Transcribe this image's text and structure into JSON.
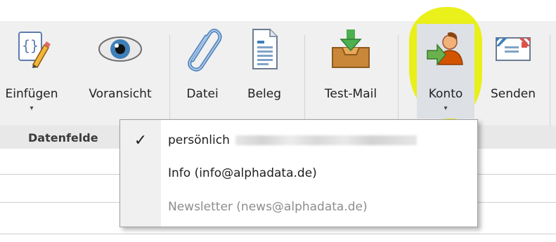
{
  "ribbon": {
    "buttons": [
      {
        "label": "Einfügen",
        "icon": "insert-field-icon",
        "has_dropdown": true
      },
      {
        "label": "Voransicht",
        "icon": "eye-icon",
        "has_dropdown": false
      },
      {
        "label": "Datei",
        "icon": "paperclip-icon",
        "has_dropdown": false
      },
      {
        "label": "Beleg",
        "icon": "document-icon",
        "has_dropdown": false
      },
      {
        "label": "Test-Mail",
        "icon": "inbox-download-icon",
        "has_dropdown": false
      },
      {
        "label": "Konto",
        "icon": "user-account-icon",
        "has_dropdown": true
      },
      {
        "label": "Senden",
        "icon": "envelope-icon",
        "has_dropdown": false
      }
    ],
    "group_label": "Datenfelde"
  },
  "dropdown_arrow": "▾",
  "konto_menu": {
    "items": [
      {
        "label": "persönlich",
        "checked": true,
        "enabled": true
      },
      {
        "label": "Info (info@alphadata.de)",
        "checked": false,
        "enabled": true
      },
      {
        "label": "Newsletter (news@alphadata.de)",
        "checked": false,
        "enabled": false
      }
    ],
    "check_glyph": "✓"
  },
  "colors": {
    "ribbon_bg": "#f0f0f0",
    "highlight_marker": "#e8ee00",
    "menu_gutter": "#f0f0f0",
    "disabled_text": "#8d8d8d"
  }
}
